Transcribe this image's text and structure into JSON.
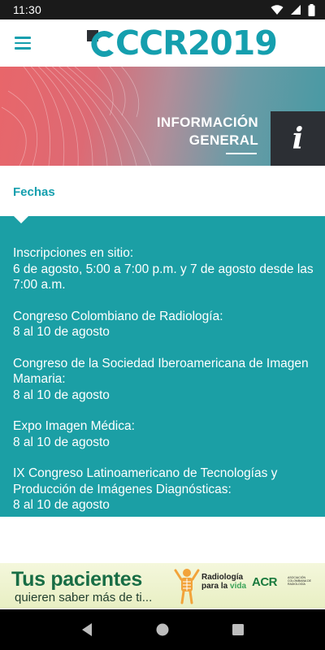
{
  "status_bar": {
    "time": "11:30",
    "icons": [
      "wifi-icon",
      "signal-icon",
      "battery-icon"
    ]
  },
  "app_bar": {
    "logo_text": "CCR2019",
    "menu_icon": "hamburger-menu-icon"
  },
  "banner": {
    "title_line1": "INFORMACIÓN",
    "title_line2": "GENERAL",
    "info_icon": "i"
  },
  "section": {
    "title": "Fechas"
  },
  "entries": [
    {
      "title": "Inscripciones en sitio:",
      "detail": "6 de agosto, 5:00 a 7:00 p.m. y 7 de agosto desde las 7:00 a.m."
    },
    {
      "title": "Congreso Colombiano de Radiología:",
      "detail": "8 al 10 de agosto"
    },
    {
      "title": "Congreso de la Sociedad Iberoamericana de Imagen Mamaria:",
      "detail": "8 al 10 de agosto"
    },
    {
      "title": "Expo Imagen Médica:",
      "detail": "8 al 10 de agosto"
    },
    {
      "title": "IX Congreso Latinoamericano de Tecnologías y Producción de Imágenes Diagnósticas:",
      "detail": "8 al 10 de agosto"
    }
  ],
  "ad": {
    "title": "Tus pacientes",
    "subtitle": "quieren saber más de ti...",
    "brand_line1": "Radiología",
    "brand_line2_prefix": "para la ",
    "brand_line2_accent": "vida",
    "acr": "ACR",
    "acr_sub": "ASOCIACIÓN COLOMBIANA DE RADIOLOGÍA"
  },
  "nav_bar": {
    "buttons": [
      "back-icon",
      "home-icon",
      "recents-icon"
    ]
  },
  "colors": {
    "accent": "#159fae",
    "content_bg": "#1b9fa5",
    "info_box": "#2c2f34"
  }
}
